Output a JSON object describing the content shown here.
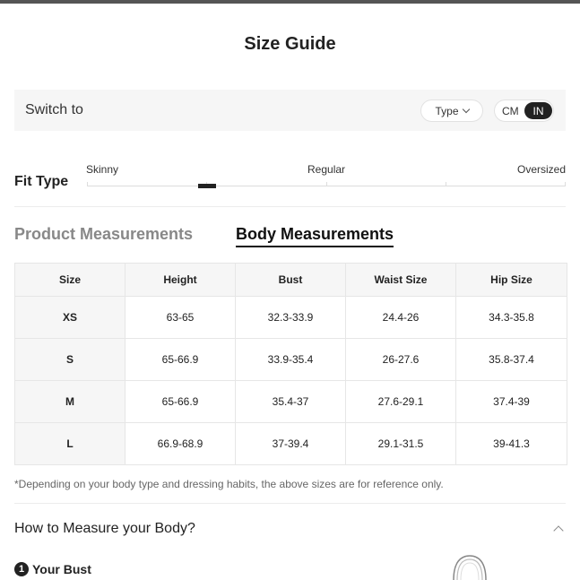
{
  "title": "Size Guide",
  "switch": {
    "label": "Switch to",
    "type_label": "Type",
    "unit_cm": "CM",
    "unit_in": "IN",
    "selected_unit": "IN"
  },
  "fit": {
    "label": "Fit Type",
    "options": [
      "Skinny",
      "Regular",
      "Oversized"
    ],
    "selected_fraction": 0.25
  },
  "tabs": {
    "product": "Product Measurements",
    "body": "Body Measurements",
    "active": "body"
  },
  "table": {
    "headers": [
      "Size",
      "Height",
      "Bust",
      "Waist Size",
      "Hip Size"
    ],
    "rows": [
      [
        "XS",
        "63-65",
        "32.3-33.9",
        "24.4-26",
        "34.3-35.8"
      ],
      [
        "S",
        "65-66.9",
        "33.9-35.4",
        "26-27.6",
        "35.8-37.4"
      ],
      [
        "M",
        "65-66.9",
        "35.4-37",
        "27.6-29.1",
        "37.4-39"
      ],
      [
        "L",
        "66.9-68.9",
        "37-39.4",
        "29.1-31.5",
        "39-41.3"
      ]
    ]
  },
  "note": "*Depending on your body type and dressing habits, the above sizes are for reference only.",
  "how_to": {
    "title": "How to Measure your Body?",
    "step_number": "1",
    "step_title": "Your Bust"
  },
  "icons": {
    "type_dropdown": "chevron-down-icon",
    "collapse": "chevron-up-icon",
    "figure": "body-figure-icon"
  },
  "colors": {
    "accent": "#222222",
    "panel_bg": "#f6f6f6",
    "inactive_tab": "#888888"
  }
}
